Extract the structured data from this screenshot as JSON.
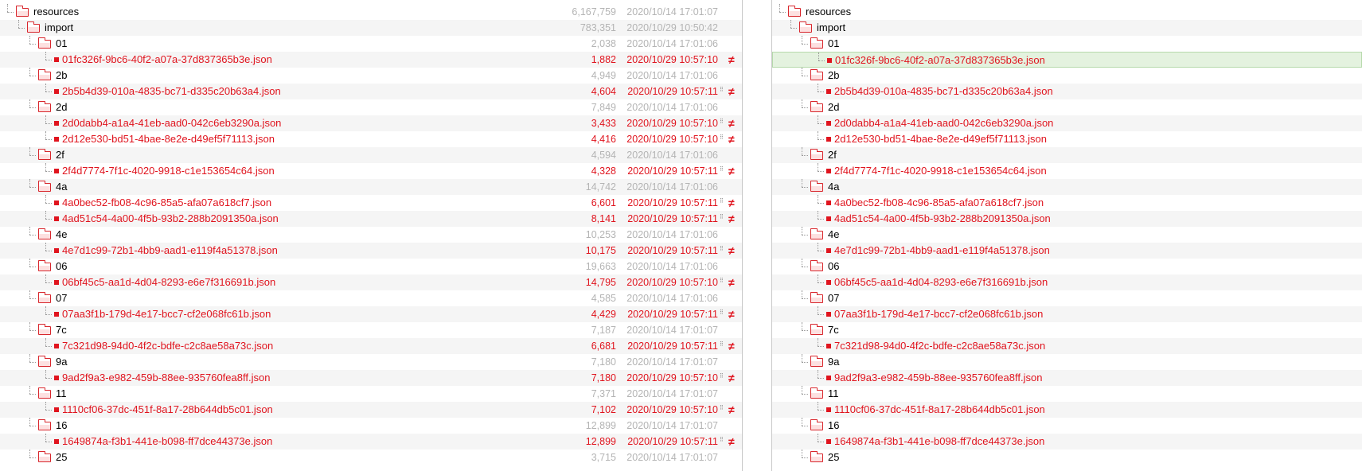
{
  "colors": {
    "diff_text": "#e0141e",
    "dim_text": "#b4b4b4",
    "selected_row_bg": "#e4f2df",
    "alt_row_bg": "#f5f5f5"
  },
  "icons": {
    "folder": "folder-open-icon",
    "file": "file-icon",
    "different": "not-equal-icon",
    "split": "split-view-icon"
  },
  "left": {
    "rows": [
      {
        "type": "folder",
        "level": 1,
        "name": "resources",
        "size": "6,167,759",
        "date": "2020/10/14 17:01:07",
        "diff": false
      },
      {
        "type": "folder",
        "level": 2,
        "name": "import",
        "size": "783,351",
        "date": "2020/10/29 10:50:42",
        "diff": false
      },
      {
        "type": "folder",
        "level": 3,
        "name": "01",
        "size": "2,038",
        "date": "2020/10/14 17:01:06",
        "diff": false
      },
      {
        "type": "file",
        "level": 4,
        "name": "01fc326f-9bc6-40f2-a07a-37d837365b3e.json",
        "size": "1,882",
        "date": "2020/10/29 10:57:10",
        "diff": true,
        "split": false
      },
      {
        "type": "folder",
        "level": 3,
        "name": "2b",
        "size": "4,949",
        "date": "2020/10/14 17:01:06",
        "diff": false
      },
      {
        "type": "file",
        "level": 4,
        "name": "2b5b4d39-010a-4835-bc71-d335c20b63a4.json",
        "size": "4,604",
        "date": "2020/10/29 10:57:11",
        "diff": true,
        "split": true
      },
      {
        "type": "folder",
        "level": 3,
        "name": "2d",
        "size": "7,849",
        "date": "2020/10/14 17:01:06",
        "diff": false
      },
      {
        "type": "file",
        "level": 4,
        "name": "2d0dabb4-a1a4-41eb-aad0-042c6eb3290a.json",
        "size": "3,433",
        "date": "2020/10/29 10:57:10",
        "diff": true,
        "split": true
      },
      {
        "type": "file",
        "level": 4,
        "name": "2d12e530-bd51-4bae-8e2e-d49ef5f71113.json",
        "size": "4,416",
        "date": "2020/10/29 10:57:10",
        "diff": true,
        "split": true
      },
      {
        "type": "folder",
        "level": 3,
        "name": "2f",
        "size": "4,594",
        "date": "2020/10/14 17:01:06",
        "diff": false
      },
      {
        "type": "file",
        "level": 4,
        "name": "2f4d7774-7f1c-4020-9918-c1e153654c64.json",
        "size": "4,328",
        "date": "2020/10/29 10:57:11",
        "diff": true,
        "split": true
      },
      {
        "type": "folder",
        "level": 3,
        "name": "4a",
        "size": "14,742",
        "date": "2020/10/14 17:01:06",
        "diff": false
      },
      {
        "type": "file",
        "level": 4,
        "name": "4a0bec52-fb08-4c96-85a5-afa07a618cf7.json",
        "size": "6,601",
        "date": "2020/10/29 10:57:11",
        "diff": true,
        "split": true
      },
      {
        "type": "file",
        "level": 4,
        "name": "4ad51c54-4a00-4f5b-93b2-288b2091350a.json",
        "size": "8,141",
        "date": "2020/10/29 10:57:11",
        "diff": true,
        "split": true
      },
      {
        "type": "folder",
        "level": 3,
        "name": "4e",
        "size": "10,253",
        "date": "2020/10/14 17:01:06",
        "diff": false
      },
      {
        "type": "file",
        "level": 4,
        "name": "4e7d1c99-72b1-4bb9-aad1-e119f4a51378.json",
        "size": "10,175",
        "date": "2020/10/29 10:57:11",
        "diff": true,
        "split": true
      },
      {
        "type": "folder",
        "level": 3,
        "name": "06",
        "size": "19,663",
        "date": "2020/10/14 17:01:06",
        "diff": false
      },
      {
        "type": "file",
        "level": 4,
        "name": "06bf45c5-aa1d-4d04-8293-e6e7f316691b.json",
        "size": "14,795",
        "date": "2020/10/29 10:57:10",
        "diff": true,
        "split": true
      },
      {
        "type": "folder",
        "level": 3,
        "name": "07",
        "size": "4,585",
        "date": "2020/10/14 17:01:06",
        "diff": false
      },
      {
        "type": "file",
        "level": 4,
        "name": "07aa3f1b-179d-4e17-bcc7-cf2e068fc61b.json",
        "size": "4,429",
        "date": "2020/10/29 10:57:11",
        "diff": true,
        "split": true
      },
      {
        "type": "folder",
        "level": 3,
        "name": "7c",
        "size": "7,187",
        "date": "2020/10/14 17:01:07",
        "diff": false
      },
      {
        "type": "file",
        "level": 4,
        "name": "7c321d98-94d0-4f2c-bdfe-c2c8ae58a73c.json",
        "size": "6,681",
        "date": "2020/10/29 10:57:11",
        "diff": true,
        "split": true
      },
      {
        "type": "folder",
        "level": 3,
        "name": "9a",
        "size": "7,180",
        "date": "2020/10/14 17:01:07",
        "diff": false
      },
      {
        "type": "file",
        "level": 4,
        "name": "9ad2f9a3-e982-459b-88ee-935760fea8ff.json",
        "size": "7,180",
        "date": "2020/10/29 10:57:10",
        "diff": true,
        "split": true
      },
      {
        "type": "folder",
        "level": 3,
        "name": "11",
        "size": "7,371",
        "date": "2020/10/14 17:01:07",
        "diff": false
      },
      {
        "type": "file",
        "level": 4,
        "name": "1110cf06-37dc-451f-8a17-28b644db5c01.json",
        "size": "7,102",
        "date": "2020/10/29 10:57:10",
        "diff": true,
        "split": true
      },
      {
        "type": "folder",
        "level": 3,
        "name": "16",
        "size": "12,899",
        "date": "2020/10/14 17:01:07",
        "diff": false
      },
      {
        "type": "file",
        "level": 4,
        "name": "1649874a-f3b1-441e-b098-ff7dce44373e.json",
        "size": "12,899",
        "date": "2020/10/29 10:57:11",
        "diff": true,
        "split": true
      },
      {
        "type": "folder",
        "level": 3,
        "name": "25",
        "size": "3,715",
        "date": "2020/10/14 17:01:07",
        "diff": false
      }
    ]
  },
  "right": {
    "selected_index": 3,
    "rows": [
      {
        "type": "folder",
        "level": 1,
        "name": "resources",
        "diff": false
      },
      {
        "type": "folder",
        "level": 2,
        "name": "import",
        "diff": false
      },
      {
        "type": "folder",
        "level": 3,
        "name": "01",
        "diff": false
      },
      {
        "type": "file",
        "level": 4,
        "name": "01fc326f-9bc6-40f2-a07a-37d837365b3e.json",
        "diff": true
      },
      {
        "type": "folder",
        "level": 3,
        "name": "2b",
        "diff": false
      },
      {
        "type": "file",
        "level": 4,
        "name": "2b5b4d39-010a-4835-bc71-d335c20b63a4.json",
        "diff": true
      },
      {
        "type": "folder",
        "level": 3,
        "name": "2d",
        "diff": false
      },
      {
        "type": "file",
        "level": 4,
        "name": "2d0dabb4-a1a4-41eb-aad0-042c6eb3290a.json",
        "diff": true
      },
      {
        "type": "file",
        "level": 4,
        "name": "2d12e530-bd51-4bae-8e2e-d49ef5f71113.json",
        "diff": true
      },
      {
        "type": "folder",
        "level": 3,
        "name": "2f",
        "diff": false
      },
      {
        "type": "file",
        "level": 4,
        "name": "2f4d7774-7f1c-4020-9918-c1e153654c64.json",
        "diff": true
      },
      {
        "type": "folder",
        "level": 3,
        "name": "4a",
        "diff": false
      },
      {
        "type": "file",
        "level": 4,
        "name": "4a0bec52-fb08-4c96-85a5-afa07a618cf7.json",
        "diff": true
      },
      {
        "type": "file",
        "level": 4,
        "name": "4ad51c54-4a00-4f5b-93b2-288b2091350a.json",
        "diff": true
      },
      {
        "type": "folder",
        "level": 3,
        "name": "4e",
        "diff": false
      },
      {
        "type": "file",
        "level": 4,
        "name": "4e7d1c99-72b1-4bb9-aad1-e119f4a51378.json",
        "diff": true
      },
      {
        "type": "folder",
        "level": 3,
        "name": "06",
        "diff": false
      },
      {
        "type": "file",
        "level": 4,
        "name": "06bf45c5-aa1d-4d04-8293-e6e7f316691b.json",
        "diff": true
      },
      {
        "type": "folder",
        "level": 3,
        "name": "07",
        "diff": false
      },
      {
        "type": "file",
        "level": 4,
        "name": "07aa3f1b-179d-4e17-bcc7-cf2e068fc61b.json",
        "diff": true
      },
      {
        "type": "folder",
        "level": 3,
        "name": "7c",
        "diff": false
      },
      {
        "type": "file",
        "level": 4,
        "name": "7c321d98-94d0-4f2c-bdfe-c2c8ae58a73c.json",
        "diff": true
      },
      {
        "type": "folder",
        "level": 3,
        "name": "9a",
        "diff": false
      },
      {
        "type": "file",
        "level": 4,
        "name": "9ad2f9a3-e982-459b-88ee-935760fea8ff.json",
        "diff": true
      },
      {
        "type": "folder",
        "level": 3,
        "name": "11",
        "diff": false
      },
      {
        "type": "file",
        "level": 4,
        "name": "1110cf06-37dc-451f-8a17-28b644db5c01.json",
        "diff": true
      },
      {
        "type": "folder",
        "level": 3,
        "name": "16",
        "diff": false
      },
      {
        "type": "file",
        "level": 4,
        "name": "1649874a-f3b1-441e-b098-ff7dce44373e.json",
        "diff": true
      },
      {
        "type": "folder",
        "level": 3,
        "name": "25",
        "diff": false
      }
    ]
  }
}
